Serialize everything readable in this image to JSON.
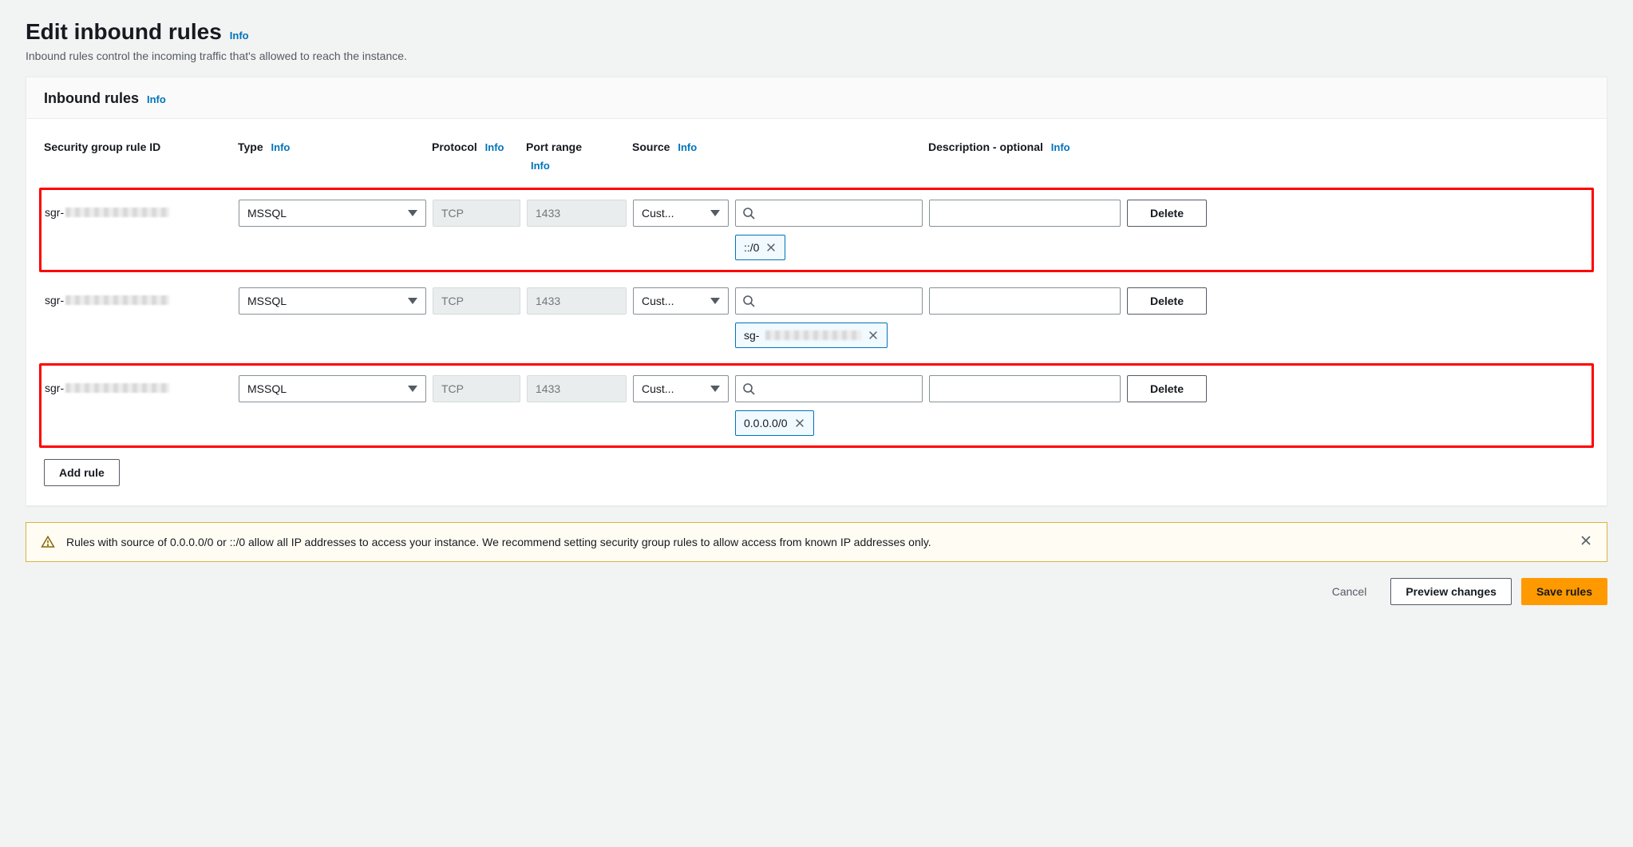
{
  "header": {
    "title": "Edit inbound rules",
    "info": "Info",
    "subtitle": "Inbound rules control the incoming traffic that's allowed to reach the instance."
  },
  "panel": {
    "title": "Inbound rules",
    "info": "Info"
  },
  "columns": {
    "sgr_id": "Security group rule ID",
    "type": "Type",
    "type_info": "Info",
    "protocol": "Protocol",
    "protocol_info": "Info",
    "port_range": "Port range",
    "port_range_info": "Info",
    "source": "Source",
    "source_info": "Info",
    "description": "Description - optional",
    "description_info": "Info"
  },
  "rules": [
    {
      "highlight": true,
      "sgr_prefix": "sgr-",
      "type": "MSSQL",
      "protocol": "TCP",
      "port_range": "1433",
      "source_type": "Cust...",
      "source_token": "::/0",
      "source_token_blurred": false,
      "description": ""
    },
    {
      "highlight": false,
      "sgr_prefix": "sgr-",
      "type": "MSSQL",
      "protocol": "TCP",
      "port_range": "1433",
      "source_type": "Cust...",
      "source_token": "sg-",
      "source_token_blurred": true,
      "description": ""
    },
    {
      "highlight": true,
      "sgr_prefix": "sgr-",
      "type": "MSSQL",
      "protocol": "TCP",
      "port_range": "1433",
      "source_type": "Cust...",
      "source_token": "0.0.0.0/0",
      "source_token_blurred": false,
      "description": ""
    }
  ],
  "buttons": {
    "delete": "Delete",
    "add_rule": "Add rule",
    "cancel": "Cancel",
    "preview": "Preview changes",
    "save": "Save rules"
  },
  "alert": {
    "message": "Rules with source of 0.0.0.0/0 or ::/0 allow all IP addresses to access your instance. We recommend setting security group rules to allow access from known IP addresses only."
  }
}
